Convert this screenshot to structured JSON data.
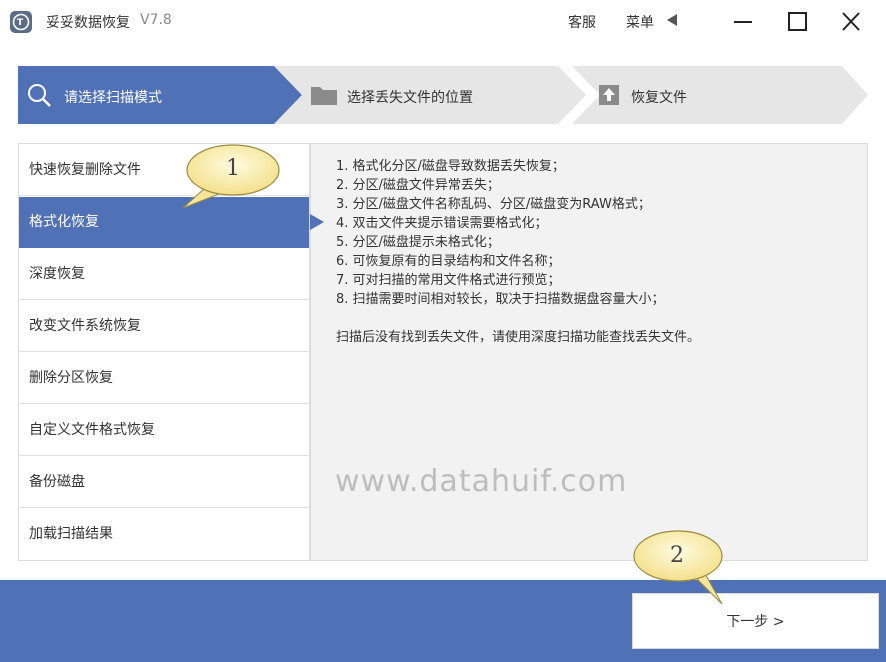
{
  "window": {
    "title": "妥妥数据恢复",
    "version": "V7.8",
    "service_label": "客服",
    "menu_label": "菜单"
  },
  "steps": [
    {
      "label": "请选择扫描模式",
      "icon": "search-icon",
      "active": true
    },
    {
      "label": "选择丢失文件的位置",
      "icon": "folder-icon",
      "active": false
    },
    {
      "label": "恢复文件",
      "icon": "upload-icon",
      "active": false
    }
  ],
  "modes": [
    {
      "label": "快速恢复删除文件"
    },
    {
      "label": "格式化恢复",
      "selected": true
    },
    {
      "label": "深度恢复"
    },
    {
      "label": "改变文件系统恢复"
    },
    {
      "label": "删除分区恢复"
    },
    {
      "label": "自定义文件格式恢复"
    },
    {
      "label": "备份磁盘"
    },
    {
      "label": "加载扫描结果"
    }
  ],
  "description": {
    "lines": [
      "1. 格式化分区/磁盘导致数据丢失恢复；",
      "2. 分区/磁盘文件异常丢失；",
      "3. 分区/磁盘文件名称乱码、分区/磁盘变为RAW格式；",
      "4. 双击文件夹提示错误需要格式化；",
      "5. 分区/磁盘提示未格式化；",
      "6. 可恢复原有的目录结构和文件名称；",
      "7. 可对扫描的常用文件格式进行预览；",
      "8. 扫描需要时间相对较长，取决于扫描数据盘容量大小；"
    ],
    "note": "扫描后没有找到丢失文件，请使用深度扫描功能查找丢失文件。"
  },
  "watermark": "www.datahuif.com",
  "footer": {
    "next_label": "下一步 >"
  },
  "callouts": [
    {
      "number": "1"
    },
    {
      "number": "2"
    }
  ],
  "colors": {
    "accent": "#5071b5",
    "step_inactive": "#e6e6e6",
    "panel_bg": "#f2f2f2"
  }
}
